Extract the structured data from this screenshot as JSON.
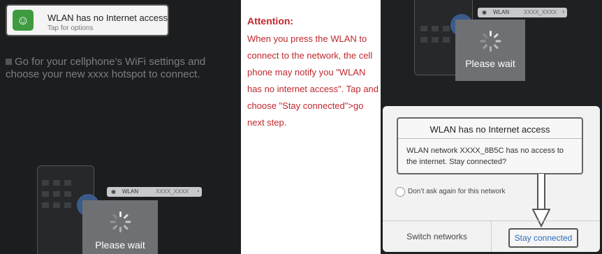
{
  "notification": {
    "title": "WLAN has no Internet access",
    "subtitle": "Tap for options",
    "app_icon": "android-icon"
  },
  "left_instruction": "Go for your cellphone’s WiFi settings and choose your new  xxxx  hotspot to connect.",
  "phone_mock": {
    "wlan_label": "WLAN",
    "ssid_mask": "XXXX_XXXX",
    "wait_text": "Please wait"
  },
  "attention": {
    "title": "Attention:",
    "body": "When you press the WLAN to connect to the network, the cell phone may notify you \"WLAN has no internet access\". Tap and choose \"Stay connected\">go next step."
  },
  "dialog": {
    "title": "WLAN has no Internet access",
    "message": "WLAN network XXXX_8B5C has no access to the internet. Stay connected?",
    "dont_ask": "Don’t ask again for this network",
    "switch_label": "Switch networks",
    "stay_label": "Stay connected"
  },
  "colors": {
    "attention_red": "#c1272d",
    "stay_blue": "#2a6db8",
    "app_green": "#3f9b3f"
  }
}
